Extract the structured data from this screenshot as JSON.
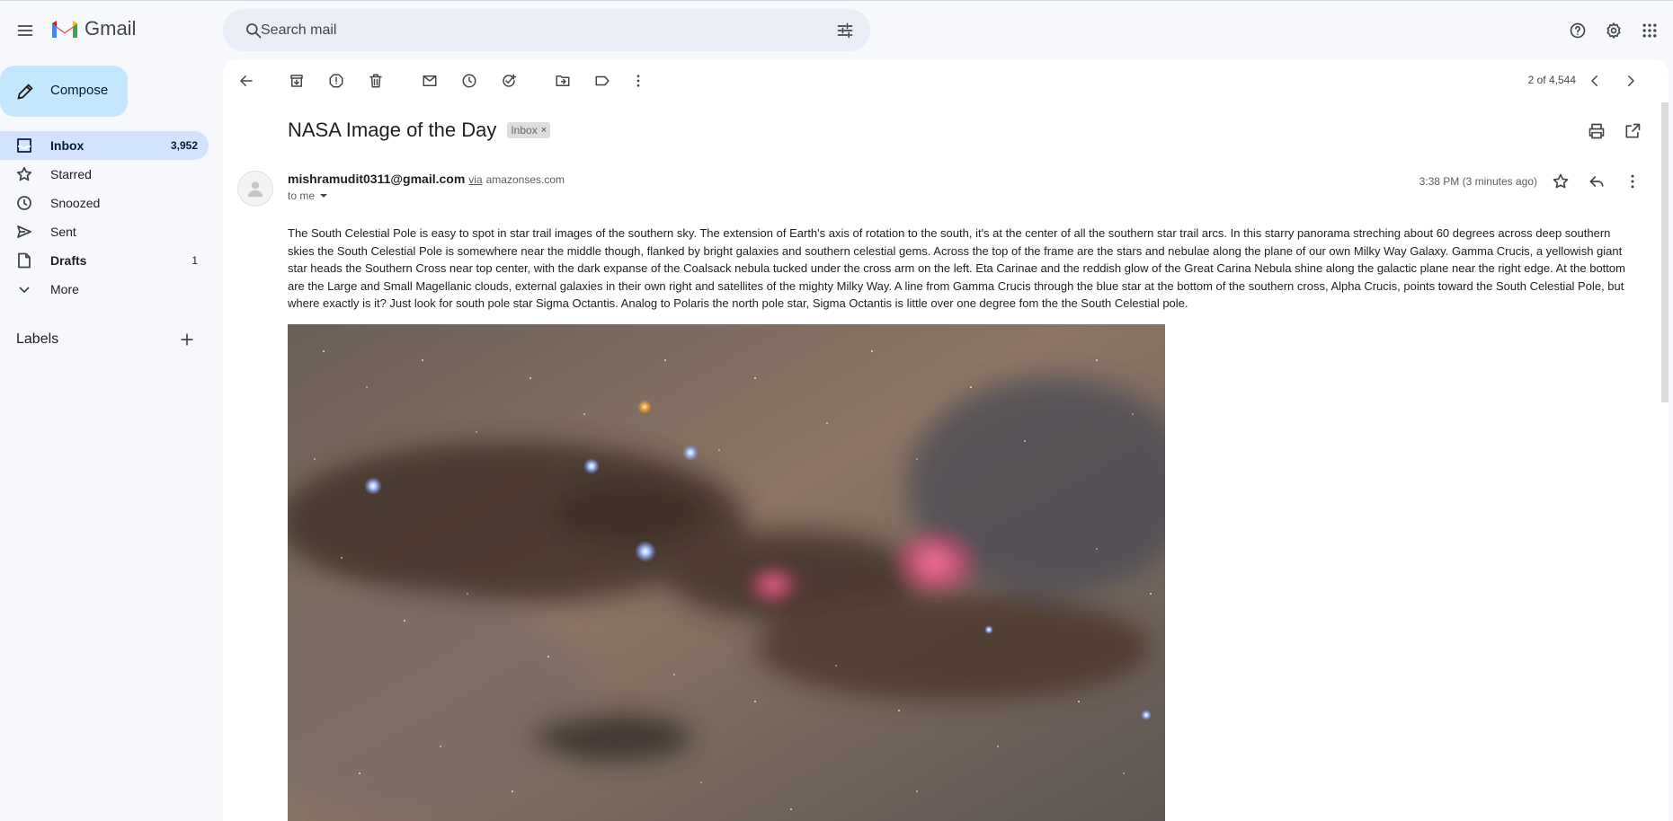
{
  "app": {
    "name": "Gmail"
  },
  "search": {
    "placeholder": "Search mail"
  },
  "sidebar": {
    "compose_label": "Compose",
    "items": [
      {
        "label": "Inbox",
        "count": "3,952",
        "icon": "inbox-icon"
      },
      {
        "label": "Starred",
        "count": "",
        "icon": "star-icon"
      },
      {
        "label": "Snoozed",
        "count": "",
        "icon": "clock-icon"
      },
      {
        "label": "Sent",
        "count": "",
        "icon": "send-icon"
      },
      {
        "label": "Drafts",
        "count": "1",
        "icon": "draft-icon"
      },
      {
        "label": "More",
        "count": "",
        "icon": "chevron-down-icon"
      }
    ],
    "labels_heading": "Labels"
  },
  "toolbar": {
    "pager": "2 of 4,544"
  },
  "email": {
    "subject": "NASA Image of the Day",
    "label_chip": "Inbox",
    "sender_email": "mishramudit0311@gmail.com",
    "via": "via",
    "via_domain": "amazonses.com",
    "to": "to me",
    "time": "3:38 PM (3 minutes ago)",
    "body": "The South Celestial Pole is easy to spot in star trail images of the southern sky. The extension of Earth's axis of rotation to the south, it's at the center of all the southern star trail arcs. In this starry panorama streching about 60 degrees across deep southern skies the South Celestial Pole is somewhere near the middle though, flanked by bright galaxies and southern celestial gems. Across the top of the frame are the stars and nebulae along the plane of our own Milky Way Galaxy. Gamma Crucis, a yellowish giant star heads the Southern Cross near top center, with the dark expanse of the Coalsack nebula tucked under the cross arm on the left. Eta Carinae and the reddish glow of the Great Carina Nebula shine along the galactic plane near the right edge. At the bottom are the Large and Small Magellanic clouds, external galaxies in their own right and satellites of the mighty Milky Way. A line from Gamma Crucis through the blue star at the bottom of the southern cross, Alpha Crucis, points toward the South Celestial Pole, but where exactly is it? Just look for south pole star Sigma Octantis. Analog to Polaris the north pole star, Sigma Octantis is little over one degree fom the the South Celestial pole."
  }
}
